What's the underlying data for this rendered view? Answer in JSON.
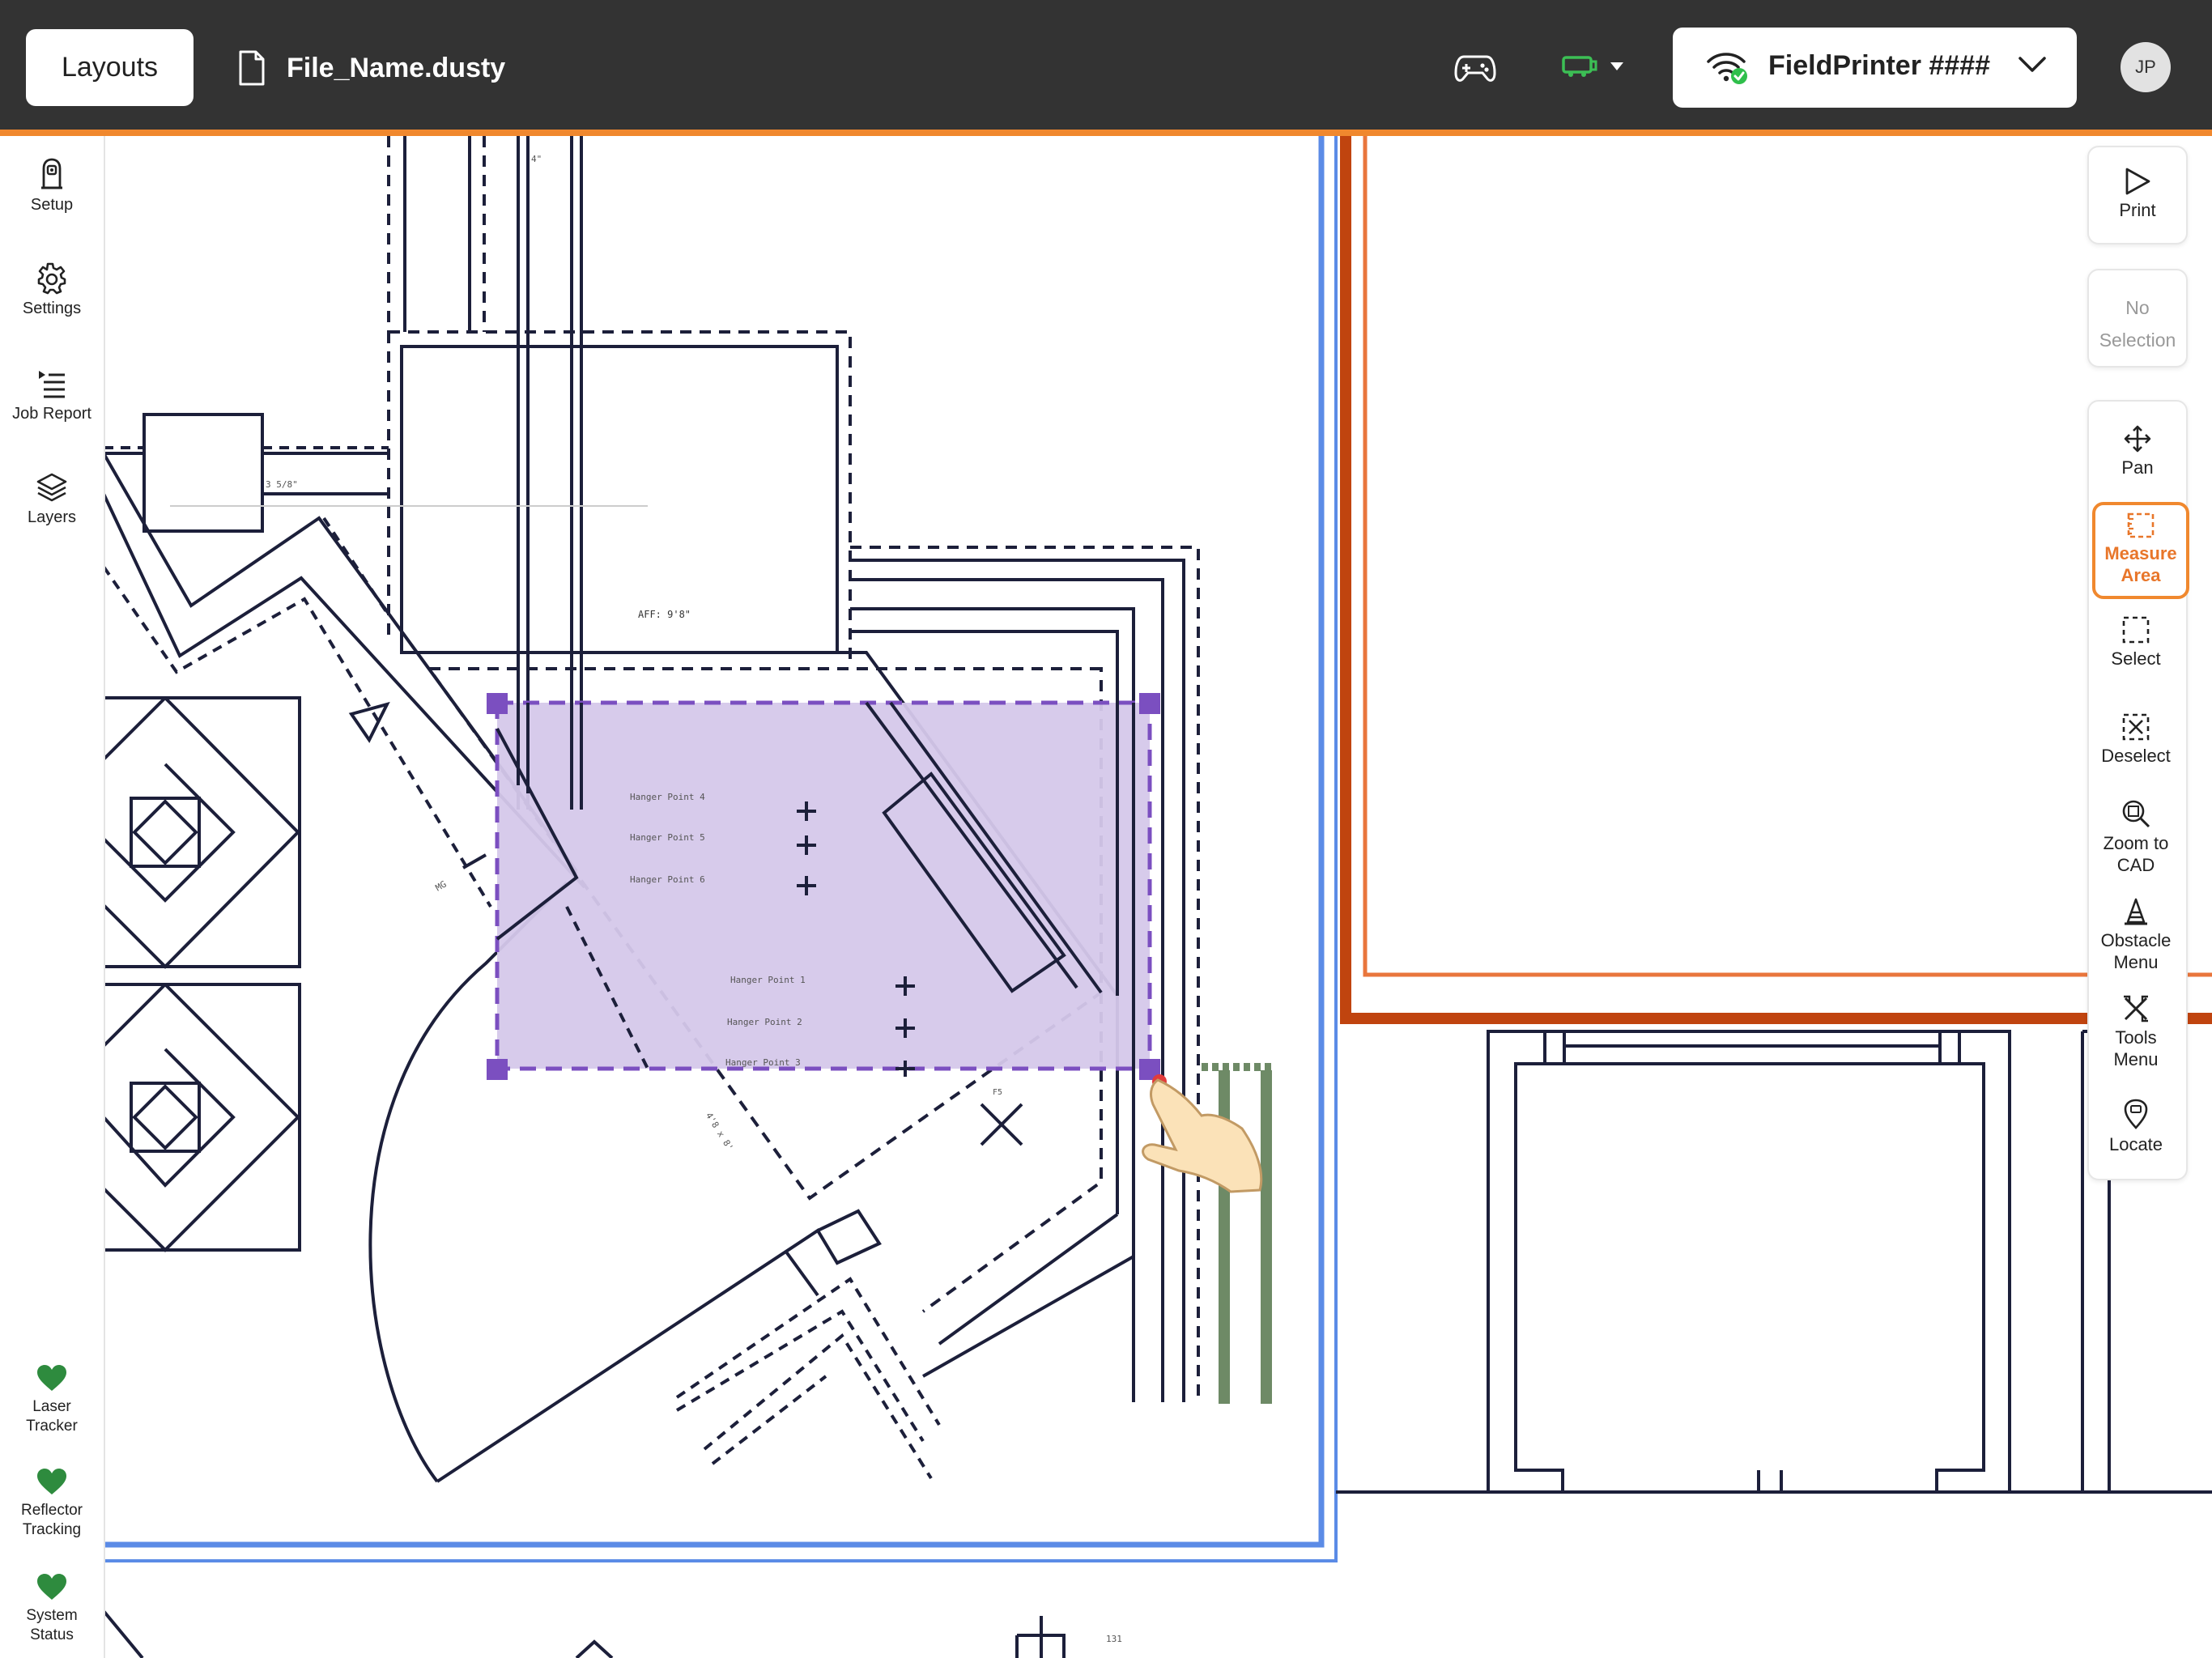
{
  "header": {
    "layouts_button": "Layouts",
    "file_name": "File_Name.dusty",
    "printer_name": "FieldPrinter ####",
    "avatar_initials": "JP"
  },
  "left_nav": {
    "items": [
      {
        "label": "Setup",
        "icon": "tracker-icon"
      },
      {
        "label": "Settings",
        "icon": "gear-icon"
      },
      {
        "label": "Job Report",
        "icon": "job-report-icon"
      },
      {
        "label": "Layers",
        "icon": "layers-icon"
      }
    ],
    "status": [
      {
        "line1": "Laser",
        "line2": "Tracker",
        "color": "#2e8b3e"
      },
      {
        "line1": "Reflector",
        "line2": "Tracking",
        "color": "#2e8b3e"
      },
      {
        "line1": "System",
        "line2": "Status",
        "color": "#2e8b3e"
      }
    ]
  },
  "right_toolbar": {
    "print": "Print",
    "selection_line1": "No",
    "selection_line2": "Selection",
    "pan": "Pan",
    "measure_line1": "Measure",
    "measure_line2": "Area",
    "select": "Select",
    "deselect": "Deselect",
    "zoom_line1": "Zoom to",
    "zoom_line2": "CAD",
    "obstacle_line1": "Obstacle",
    "obstacle_line2": "Menu",
    "tools_line1": "Tools",
    "tools_line2": "Menu",
    "locate": "Locate"
  },
  "cad_labels": {
    "dim_top": "4\"",
    "dim_left": "3 5/8\"",
    "aff": "AFF: 9'8\"",
    "hanger_4": "Hanger Point 4",
    "hanger_5": "Hanger Point 5",
    "hanger_6": "Hanger Point 6",
    "hanger_1": "Hanger Point 1",
    "hanger_2": "Hanger Point 2",
    "hanger_3": "Hanger Point 3",
    "dim_diag": "4'8 x 8'",
    "rotate_tag": "MG",
    "small_tag": "F5",
    "bottom_tag": "131"
  },
  "colors": {
    "accent_orange": "#f0882e",
    "selection_purple": "#7b4fc0",
    "selection_fill": "#d5c8ea",
    "drawing_line": "#1c1f3a",
    "boundary_blue": "#5b8be6",
    "boundary_rust": "#c0440f",
    "status_green": "#2e8b3e"
  }
}
